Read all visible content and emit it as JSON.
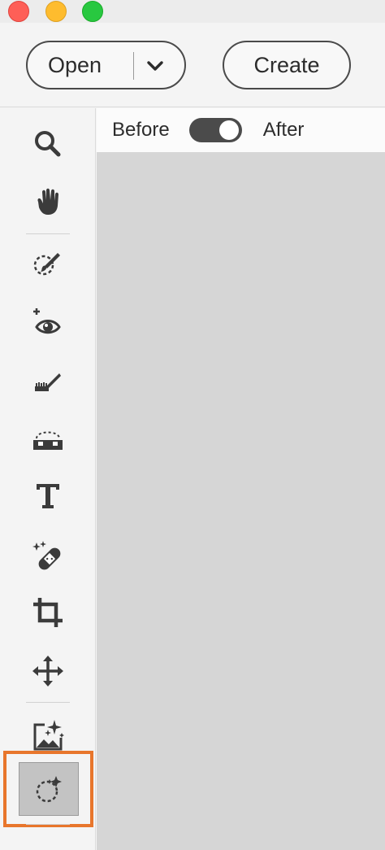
{
  "window": {
    "controls": [
      "close",
      "minimize",
      "maximize"
    ],
    "colors": {
      "close": "#fe5f57",
      "minimize": "#febc2e",
      "maximize": "#28c840"
    }
  },
  "topbar": {
    "open_label": "Open",
    "open_dropdown_icon": "chevron-down-icon",
    "create_label": "Create"
  },
  "view_toggle": {
    "before_label": "Before",
    "after_label": "After",
    "state": "after"
  },
  "toolbar": {
    "tools": [
      {
        "name": "zoom",
        "icon": "magnifier-icon"
      },
      {
        "name": "hand",
        "icon": "hand-icon"
      },
      {
        "name": "quick-selection",
        "icon": "selection-brush-icon"
      },
      {
        "name": "red-eye",
        "icon": "eye-plus-icon"
      },
      {
        "name": "whiten-teeth",
        "icon": "toothbrush-icon"
      },
      {
        "name": "straighten",
        "icon": "straighten-icon"
      },
      {
        "name": "text",
        "icon": "text-icon"
      },
      {
        "name": "spot-healing",
        "icon": "bandage-icon"
      },
      {
        "name": "crop",
        "icon": "crop-icon"
      },
      {
        "name": "move",
        "icon": "move-arrows-icon"
      },
      {
        "name": "auto-creations",
        "icon": "image-sparkle-icon"
      },
      {
        "name": "auto-selection",
        "icon": "dashed-circle-sparkle-icon",
        "active": true
      }
    ],
    "highlight_color": "#e8762c"
  }
}
